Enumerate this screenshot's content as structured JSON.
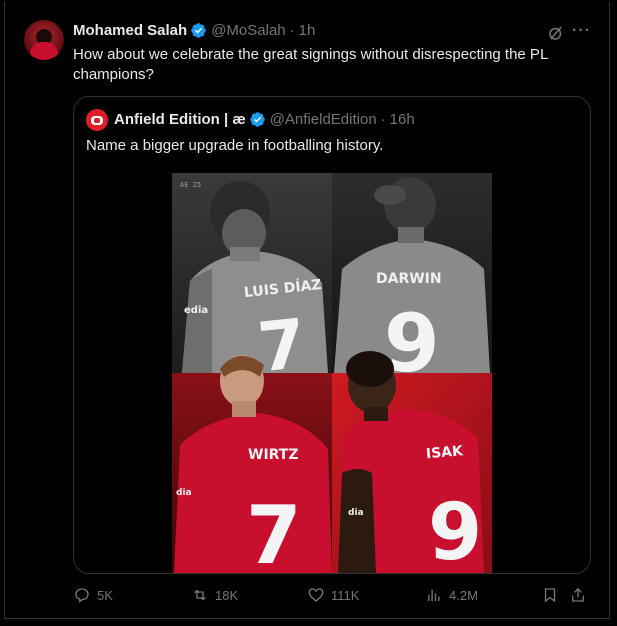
{
  "tweet": {
    "author_name": "Mohamed Salah",
    "handle": "@MoSalah",
    "separator": "·",
    "time": "1h",
    "text": "How about we celebrate the great signings without disrespecting the PL champions?",
    "more_label": "···"
  },
  "quote": {
    "author_name": "Anfield Edition | æ",
    "handle": "@AnfieldEdition",
    "separator": "·",
    "time": "16h",
    "text": "Name a bigger upgrade in footballing history.",
    "image": {
      "panels": [
        {
          "name": "LUIS DÍAZ",
          "number": "7",
          "tone": "grayscale",
          "sponsor": "edia"
        },
        {
          "name": "DARWIN",
          "number": "9",
          "tone": "grayscale",
          "sponsor": ""
        },
        {
          "name": "WIRTZ",
          "number": "7",
          "tone": "red",
          "sponsor": "dia"
        },
        {
          "name": "ISAK",
          "number": "9",
          "tone": "red",
          "sponsor": "dia"
        }
      ],
      "corner_mark": "AE 25"
    }
  },
  "actions": {
    "replies": "5K",
    "reposts": "18K",
    "likes": "111K",
    "views": "4.2M"
  },
  "colors": {
    "background": "#000000",
    "text": "#e7e9ea",
    "muted": "#71767b",
    "verified": "#1d9bf0",
    "border": "#2f3336",
    "liverpool_red": "#c8102e"
  }
}
